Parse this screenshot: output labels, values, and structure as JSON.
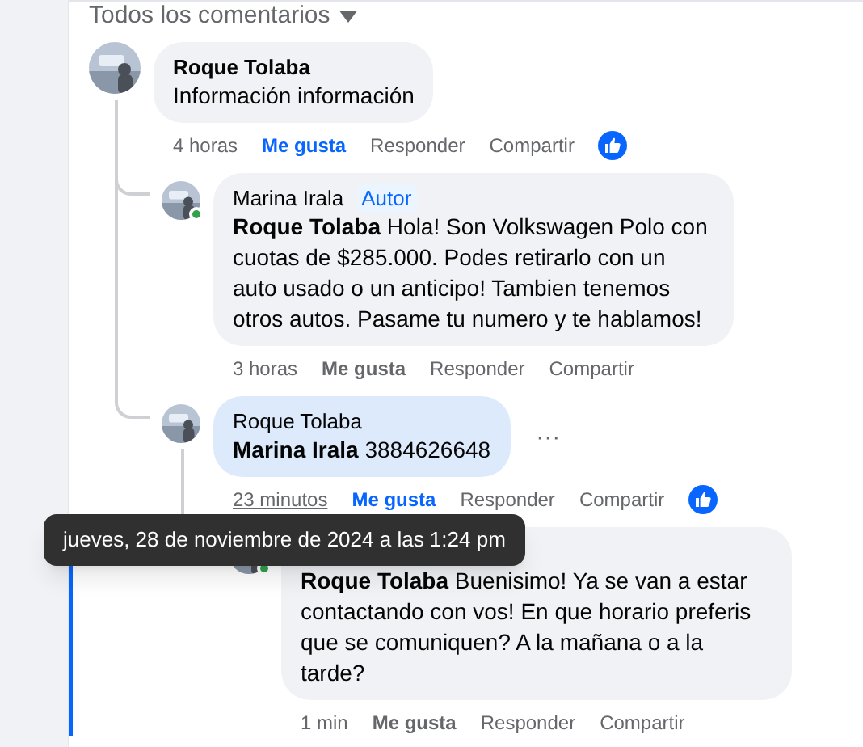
{
  "section_header": {
    "label": "Todos los comentarios"
  },
  "comments": [
    {
      "author": "Roque Tolaba",
      "text": "Información información",
      "time": "4 horas",
      "like_label": "Me gusta",
      "liked": true,
      "reply_label": "Responder",
      "share_label": "Compartir",
      "children": [
        {
          "author": "Marina Irala",
          "badge": "Autor",
          "online": true,
          "mention": "Roque Tolaba",
          "text": "Hola! Son Volkswagen Polo con cuotas de $285.000. Podes retirarlo con un auto usado o un anticipo! Tambien tenemos otros autos. Pasame tu numero y te hablamos!",
          "time": "3 horas",
          "like_label": "Me gusta",
          "liked": false,
          "reply_label": "Responder",
          "share_label": "Compartir"
        },
        {
          "author": "Roque Tolaba",
          "mention": "Marina Irala",
          "text": "3884626648",
          "time": "23 minutos",
          "time_underlined": true,
          "like_label": "Me gusta",
          "liked": true,
          "reply_label": "Responder",
          "share_label": "Compartir",
          "highlighted": true,
          "more_label": "···",
          "children": [
            {
              "online": true,
              "mention": "Roque Tolaba",
              "text": "Buenisimo! Ya se van a estar contactando con vos! En que horario preferis que se comuniquen? A la mañana o a la tarde?",
              "time": "1 min",
              "like_label": "Me gusta",
              "liked": false,
              "reply_label": "Responder",
              "share_label": "Compartir"
            }
          ]
        }
      ]
    }
  ],
  "tooltip": {
    "text": "jueves, 28 de noviembre de 2024 a las 1:24 pm"
  }
}
